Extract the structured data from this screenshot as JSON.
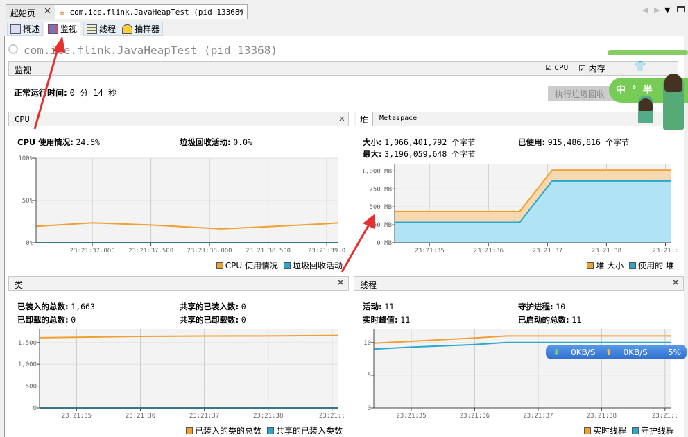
{
  "tabs": [
    {
      "label": "起始页"
    },
    {
      "label": "com.ice.flink.JavaHeapTest (pid 13368)",
      "active": true
    }
  ],
  "subtabs": [
    {
      "label": "概述",
      "icon": "overview-icon"
    },
    {
      "label": "监视",
      "icon": "monitor-icon",
      "active": true
    },
    {
      "label": "线程",
      "icon": "threads-icon"
    },
    {
      "label": "抽样器",
      "icon": "sampler-icon"
    }
  ],
  "app_title": "com.ice.flink.JavaHeapTest (pid 13368)",
  "monitor": {
    "section": "监视",
    "cpu_check": "CPU",
    "mem_check": "内存",
    "uptime_label": "正常运行时间:",
    "uptime_value": "0 分 14 秒",
    "gc_button": "执行垃圾回收"
  },
  "cpu": {
    "title": "CPU",
    "usage_label": "CPU 使用情况:",
    "usage_value": "24.5%",
    "gc_label": "垃圾回收活动:",
    "gc_value": "0.0%"
  },
  "heap": {
    "tab_heap": "堆",
    "tab_meta": "Metaspace",
    "size_label": "大小:",
    "size_value": "1,066,401,792 个字节",
    "used_label": "已使用:",
    "used_value": "915,486,816 个字节",
    "max_label": "最大:",
    "max_value": "3,196,059,648 个字节"
  },
  "classes": {
    "title": "类",
    "loaded_label": "已装入的总数:",
    "loaded_value": "1,663",
    "unloaded_label": "已卸载的总数:",
    "unloaded_value": "0",
    "shared_loaded_label": "共享的已装入数:",
    "shared_loaded_value": "0",
    "shared_unloaded_label": "共享的已卸载数:",
    "shared_unloaded_value": "0"
  },
  "threads": {
    "title": "线程",
    "live_label": "活动:",
    "live_value": "11",
    "peak_label": "实时峰值:",
    "peak_value": "11",
    "daemon_label": "守护进程:",
    "daemon_value": "10",
    "started_label": "已启动的总数:",
    "started_value": "11"
  },
  "net_widget": {
    "down": "0KB/S",
    "up": "0KB/S",
    "percent": "5%"
  },
  "sticker": {
    "chars": "中 ° 半"
  },
  "colors": {
    "orange": "#f0a030",
    "blue": "#28a8d0",
    "annotation": "#e53030"
  },
  "chart_data": [
    {
      "id": "cpu",
      "type": "line",
      "xlim": [
        "23:21:36.52",
        "23:21:39.1"
      ],
      "ylim": [
        0,
        100
      ],
      "yticks": [
        0,
        50,
        100
      ],
      "ytick_labels": [
        "0%",
        "50%",
        "100%"
      ],
      "xticks": [
        "23:21:37.000",
        "23:21:37.500",
        "23:21:38.000",
        "23:21:38.500",
        "23:21:39.000"
      ],
      "xtick_labels": [
        "23:21:37.000",
        "23:21:37.500",
        "23:21:38.000",
        "23:21:38.500",
        "23:21:39.0"
      ],
      "series": [
        {
          "name": "CPU 使用情况",
          "color": "#f0a030",
          "fill": false,
          "points": [
            [
              "23:21:36.52",
              19.5
            ],
            [
              "23:21:37.0",
              23.5
            ],
            [
              "23:21:37.5",
              21
            ],
            [
              "23:21:38.1",
              16.5
            ],
            [
              "23:21:38.5",
              19
            ],
            [
              "23:21:39.0",
              22.5
            ],
            [
              "23:21:39.1",
              23.5
            ]
          ]
        },
        {
          "name": "垃圾回收活动",
          "color": "#28a8d0",
          "fill": false,
          "points": [
            [
              "23:21:36.52",
              0
            ],
            [
              "23:21:39.1",
              0
            ]
          ]
        }
      ]
    },
    {
      "id": "heap",
      "type": "area",
      "xlim": [
        "23:21:34.41",
        "23:21:39.1"
      ],
      "ylim": [
        0,
        1100
      ],
      "yticks": [
        0,
        250,
        500,
        750,
        1000
      ],
      "ytick_labels": [
        "0 MB",
        "250 MB",
        "500 MB",
        "750 MB",
        "1,000 MB"
      ],
      "xticks": [
        "23:21:35",
        "23:21:36",
        "23:21:37",
        "23:21:38",
        "23:21:39"
      ],
      "xtick_labels": [
        "23:21:35",
        "23:21:36",
        "23:21:37",
        "23:21:38",
        "23:21::"
      ],
      "series": [
        {
          "name": "堆 大小",
          "color": "#f0a030",
          "fill": "#f8d8b0",
          "points": [
            [
              "23:21:34.41",
              435
            ],
            [
              "23:21:36.53",
              435
            ],
            [
              "23:21:37.08",
              1010
            ],
            [
              "23:21:39.1",
              1010
            ]
          ]
        },
        {
          "name": "使用的 堆",
          "color": "#28a8d0",
          "fill": "#b0e4f4",
          "points": [
            [
              "23:21:34.41",
              285
            ],
            [
              "23:21:36.53",
              285
            ],
            [
              "23:21:37.08",
              860
            ],
            [
              "23:21:39.1",
              860
            ]
          ]
        }
      ]
    },
    {
      "id": "classes",
      "type": "line",
      "xlim": [
        "23:21:34.42",
        "23:21:39.1"
      ],
      "ylim": [
        0,
        1800
      ],
      "yticks": [
        0,
        500,
        1000,
        1500
      ],
      "ytick_labels": [
        "0",
        "500",
        "1,000",
        "1,500"
      ],
      "xticks": [
        "23:21:35",
        "23:21:36",
        "23:21:37",
        "23:21:38",
        "23:21:39"
      ],
      "xtick_labels": [
        "23:21:35",
        "23:21:36",
        "23:21:37",
        "23:21:38",
        "23:21::"
      ],
      "series": [
        {
          "name": "已装入的类的总数",
          "color": "#f0a030",
          "fill": false,
          "points": [
            [
              "23:21:34.42",
              1610
            ],
            [
              "23:21:36",
              1640
            ],
            [
              "23:21:37",
              1648
            ],
            [
              "23:21:38",
              1650
            ],
            [
              "23:21:39.1",
              1663
            ]
          ]
        },
        {
          "name": "共享的已装入类数",
          "color": "#28a8d0",
          "fill": false,
          "points": [
            [
              "23:21:34.42",
              0
            ],
            [
              "23:21:39.1",
              0
            ]
          ]
        }
      ]
    },
    {
      "id": "threads",
      "type": "line",
      "xlim": [
        "23:21:34.41",
        "23:21:39.1"
      ],
      "ylim": [
        0,
        12
      ],
      "yticks": [
        0,
        5,
        10
      ],
      "ytick_labels": [
        "0",
        "5",
        "10"
      ],
      "xticks": [
        "23:21:35",
        "23:21:36",
        "23:21:37",
        "23:21:38",
        "23:21:39"
      ],
      "xtick_labels": [
        "23:21:35",
        "23:21:36",
        "23:21:37",
        "23:21:38",
        "23:21::"
      ],
      "series": [
        {
          "name": "实时线程",
          "color": "#f0a030",
          "fill": false,
          "points": [
            [
              "23:21:34.41",
              9.9
            ],
            [
              "23:21:35",
              10.2
            ],
            [
              "23:21:36",
              10.7
            ],
            [
              "23:21:36.5",
              11
            ],
            [
              "23:21:39.1",
              11
            ]
          ]
        },
        {
          "name": "守护线程",
          "color": "#28a8d0",
          "fill": false,
          "points": [
            [
              "23:21:34.41",
              9
            ],
            [
              "23:21:35",
              9.3
            ],
            [
              "23:21:36",
              9.7
            ],
            [
              "23:21:36.5",
              10
            ],
            [
              "23:21:39.1",
              10
            ]
          ]
        }
      ]
    }
  ]
}
